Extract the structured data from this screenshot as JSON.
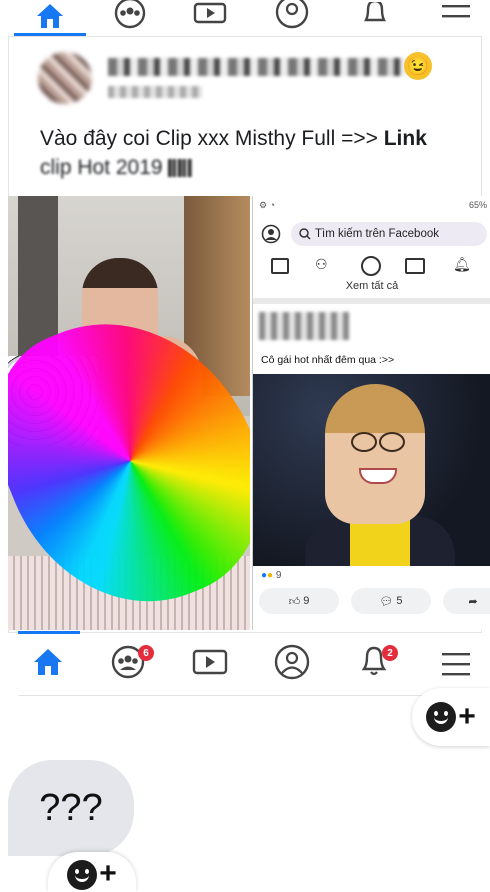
{
  "top_nav": {
    "icons": [
      "home-icon",
      "groups-icon",
      "watch-icon",
      "profile-icon",
      "notifications-icon",
      "menu-icon"
    ],
    "active": "home",
    "accent": "#1877f2"
  },
  "post": {
    "text_prefix": "Vào đây coi Clip xxx Misthy Full  =>> ",
    "text_link": "Link",
    "text_line2": "clip Hot 2019 ",
    "emoji": "😉"
  },
  "screenshot": {
    "status": "65%",
    "search_placeholder": "Tìm kiếm trên Facebook",
    "see_all": "Xem tất cả",
    "caption": "Cô gái hot nhất đêm qua :>>",
    "reaction_count": "9",
    "like_count": "9",
    "comment_count": "5"
  },
  "bottom_nav": {
    "icons": [
      "home-icon",
      "groups-icon",
      "watch-icon",
      "profile-icon",
      "notifications-icon",
      "menu-icon"
    ],
    "groups_badge": "6",
    "notifications_badge": "2"
  },
  "comment": {
    "text": "???"
  },
  "colors": {
    "accent": "#1877f2",
    "badge": "#e42d3c",
    "bubble": "#e4e6eb"
  }
}
